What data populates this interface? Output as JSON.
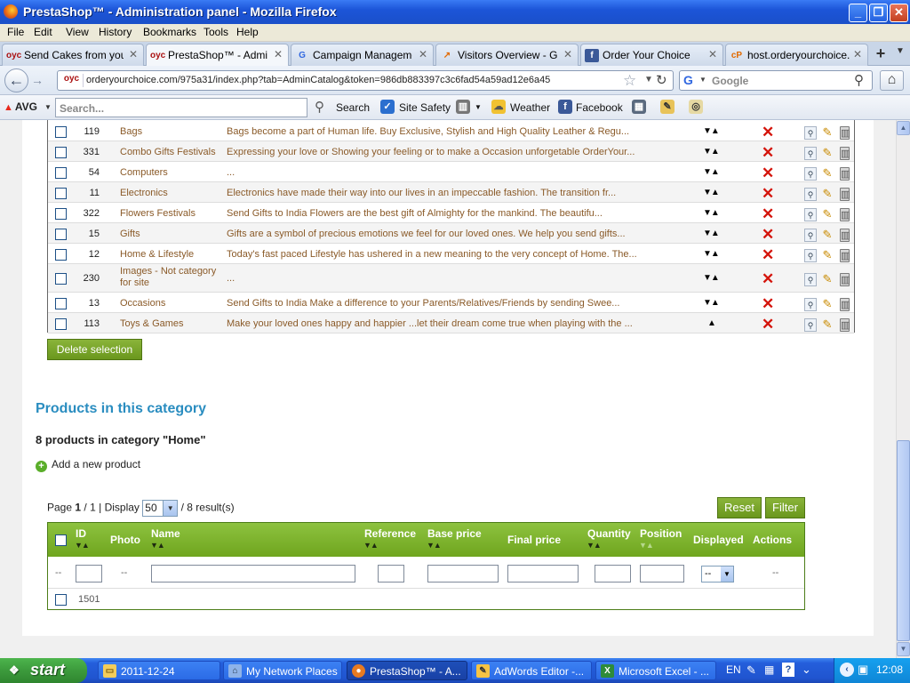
{
  "window": {
    "title": "PrestaShop™ - Administration panel - Mozilla Firefox",
    "minimize": "_",
    "maximize": "❐",
    "close": "✕"
  },
  "menu": [
    "File",
    "Edit",
    "View",
    "History",
    "Bookmarks",
    "Tools",
    "Help"
  ],
  "tabs": [
    {
      "label": "Send Cakes from your ...",
      "icon": "oyc",
      "active": false
    },
    {
      "label": "PrestaShop™ - Admini...",
      "icon": "oyc",
      "active": true
    },
    {
      "label": "Campaign Management",
      "icon": "google",
      "active": false
    },
    {
      "label": "Visitors Overview - Go...",
      "icon": "analytics",
      "active": false
    },
    {
      "label": "Order Your Choice",
      "icon": "facebook",
      "active": false
    },
    {
      "label": "host.orderyourchoice....",
      "icon": "cpanel",
      "active": false
    }
  ],
  "nav": {
    "url": "orderyourchoice.com/975a31/index.php?tab=AdminCatalog&token=986db883397c3c6fad54a59ad12e6a45",
    "search_placeholder": "Google"
  },
  "avg": {
    "logo": "AVG",
    "search_placeholder": "Search...",
    "search_label": "Search",
    "site_safety": "Site Safety",
    "weather": "Weather",
    "facebook": "Facebook"
  },
  "categories": [
    {
      "id": "119",
      "name": "Bags",
      "desc": "Bags become a part of Human life. Buy Exclusive, Stylish and High Quality Leather & Regu...",
      "arrows": "▼▲"
    },
    {
      "id": "331",
      "name": "Combo Gifts Festivals",
      "desc": "Expressing your love or Showing your feeling or to make a Occasion unforgetable OrderYour...",
      "arrows": "▼▲"
    },
    {
      "id": "54",
      "name": "Computers",
      "desc": "...",
      "arrows": "▼▲"
    },
    {
      "id": "11",
      "name": "Electronics",
      "desc": "Electronics have made their way into our lives in an impeccable fashion. The transition fr...",
      "arrows": "▼▲"
    },
    {
      "id": "322",
      "name": "Flowers Festivals",
      "desc": "Send Gifts to India Flowers are the best gift of Almighty for the mankind. The beautifu...",
      "arrows": "▼▲"
    },
    {
      "id": "15",
      "name": "Gifts",
      "desc": "Gifts are a symbol of precious emotions we feel for our loved ones. We help you send gifts...",
      "arrows": "▼▲"
    },
    {
      "id": "12",
      "name": "Home & Lifestyle",
      "desc": "Today's fast paced Lifestyle has ushered in a new meaning to the very concept of Home. The...",
      "arrows": "▼▲"
    },
    {
      "id": "230",
      "name": "Images - Not category for site",
      "desc": "...",
      "arrows": "▼▲"
    },
    {
      "id": "13",
      "name": "Occasions",
      "desc": "Send Gifts to India Make a difference to your Parents/Relatives/Friends by sending Swee...",
      "arrows": "▼▲"
    },
    {
      "id": "113",
      "name": "Toys & Games",
      "desc": "Make your loved ones happy and happier ...let their dream come true when playing with the ...",
      "arrows": "▲"
    }
  ],
  "delete_selection": "Delete selection",
  "products": {
    "title": "Products in this category",
    "count_text": "8 products in category \"Home\"",
    "add_new": "Add a new product",
    "page_label": "Page",
    "page_current": "1",
    "page_total": "1",
    "display_label": "Display",
    "display_value": "50",
    "results_text": "/ 8 result(s)",
    "reset": "Reset",
    "filter": "Filter",
    "columns": {
      "id": "ID",
      "photo": "Photo",
      "name": "Name",
      "reference": "Reference",
      "base_price": "Base price",
      "final_price": "Final price",
      "quantity": "Quantity",
      "position": "Position",
      "displayed": "Displayed",
      "actions": "Actions"
    },
    "sort_arrows": "▼▲",
    "filter_dash": "--",
    "displayed_select": "--",
    "first_row_id": "1501"
  },
  "taskbar": {
    "start": "start",
    "tasks": [
      {
        "label": "2011-12-24",
        "icon": "folder"
      },
      {
        "label": "My Network Places",
        "icon": "network"
      },
      {
        "label": "PrestaShop™ - A...",
        "icon": "firefox"
      },
      {
        "label": "AdWords Editor -...",
        "icon": "adwords"
      },
      {
        "label": "Microsoft Excel - ...",
        "icon": "excel"
      }
    ],
    "lang": "EN",
    "clock": "12:08"
  }
}
